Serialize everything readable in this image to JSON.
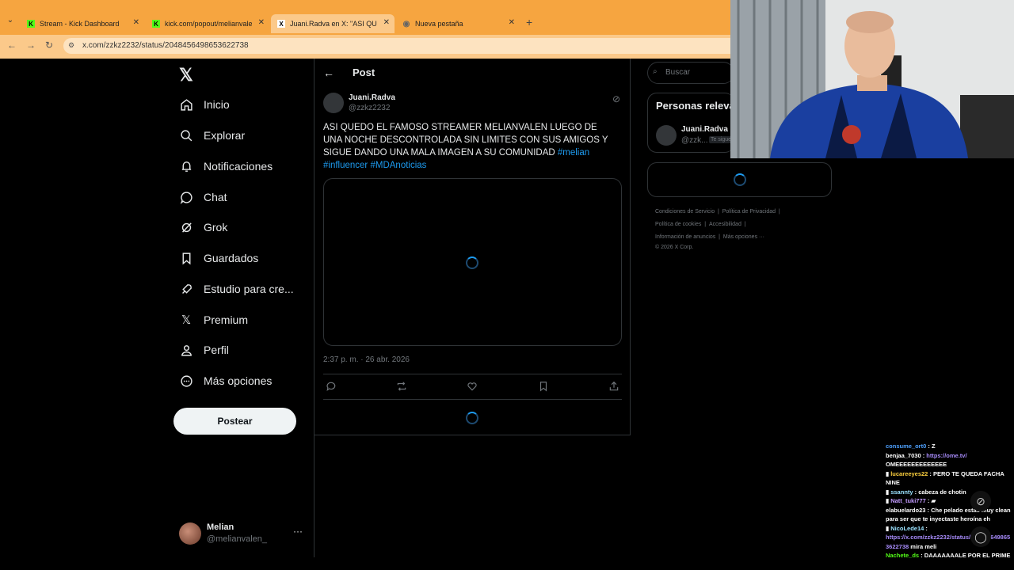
{
  "tabs": [
    {
      "title": "Stream - Kick Dashboard",
      "icon": "K",
      "color": "#53fc18"
    },
    {
      "title": "kick.com/popout/melianvalen/",
      "icon": "K",
      "color": "#53fc18"
    },
    {
      "title": "Juani.Radva en X: \"ASI QUEDO",
      "icon": "X",
      "color": "#000000"
    },
    {
      "title": "Nueva pestaña",
      "icon": "G",
      "color": "#777777"
    }
  ],
  "url": "x.com/zzkz2232/status/2048456498653622738",
  "sidebar": {
    "items": [
      {
        "label": "Inicio",
        "icon": "home-icon"
      },
      {
        "label": "Explorar",
        "icon": "search-icon"
      },
      {
        "label": "Notificaciones",
        "icon": "bell-icon"
      },
      {
        "label": "Chat",
        "icon": "chat-icon"
      },
      {
        "label": "Grok",
        "icon": "grok-icon"
      },
      {
        "label": "Guardados",
        "icon": "bookmark-icon"
      },
      {
        "label": "Estudio para cre...",
        "icon": "rocket-icon"
      },
      {
        "label": "Premium",
        "icon": "x-icon"
      },
      {
        "label": "Perfil",
        "icon": "person-icon"
      },
      {
        "label": "Más opciones",
        "icon": "more-circle-icon"
      }
    ],
    "post_button": "Postear",
    "account": {
      "name": "Melian",
      "handle": "@melianvalen_"
    }
  },
  "post": {
    "header": "Post",
    "author_name": "Juani.Radva",
    "author_handle": "@zzkz2232",
    "text_main": "ASI QUEDO EL FAMOSO STREAMER MELIANVALEN LUEGO DE UNA NOCHE DESCONTROLADA SIN LIMITES CON SUS AMIGOS Y SIGUE DANDO UNA MALA IMAGEN A SU COMUNIDAD ",
    "tag1": "#melian",
    "tag2": "#influencer",
    "tag3": "#MDAnoticias",
    "timestamp": "2:37 p. m. · 26 abr. 2026"
  },
  "right": {
    "search_placeholder": "Buscar",
    "relevant_title": "Personas relevantes",
    "rel_name": "Juani.Radva",
    "rel_handle": "@zzk...",
    "rel_badge": "Te sigue",
    "footer": {
      "tos": "Condiciones de Servicio",
      "privacy": "Política de Privacidad",
      "cookies": "Política de cookies",
      "access": "Accesibilidad",
      "ads": "Información de anuncios",
      "more": "Más opciones ···",
      "copy": "© 2026 X Corp."
    }
  },
  "chat": [
    {
      "user": "consume_ort0",
      "color": "#4ea1ff",
      "msg": "Z"
    },
    {
      "user": "benjaa_7030",
      "color": "#ffffff",
      "msg": "https://ome.tv/",
      "link": true
    },
    {
      "user": "",
      "color": "#ffffff",
      "msg": "OMEEEEEEEEEEEEE"
    },
    {
      "user": "lucareeyes22",
      "color": "#ffd23f",
      "msg": "PERO TE QUEDA FACHA NINE"
    },
    {
      "user": "ssannty",
      "color": "#9be2ff",
      "msg": "cabeza de chotin"
    },
    {
      "user": "Natt_tuki777",
      "color": "#c39bff",
      "msg": ""
    },
    {
      "user": "elabuelardo23",
      "color": "#ffffff",
      "msg": "Che pelado estas muy clean para ser que te inyectaste heroína eh"
    },
    {
      "user": "NicoLede14",
      "color": "#9be2ff",
      "msg": ""
    },
    {
      "user": "",
      "color": "#ffffff",
      "msg": "https://x.com/zzkz2232/status/2048456498653622738",
      "link": true
    },
    {
      "user": "",
      "color": "#ffffff",
      "msg": "mira meli"
    },
    {
      "user": "Nachete_ds",
      "color": "#53fc18",
      "msg": "DAAAAAAALE POR EL PRIME"
    }
  ]
}
